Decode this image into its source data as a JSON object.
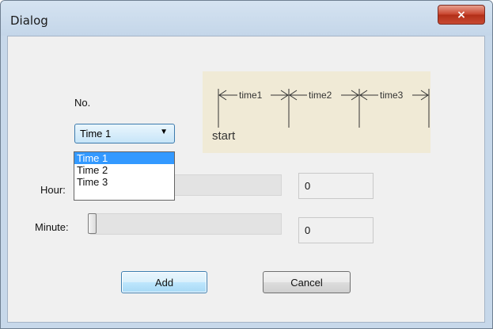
{
  "window": {
    "title": "Dialog",
    "close_glyph": "×"
  },
  "labels": {
    "no": "No.",
    "hour": "Hour:",
    "minute": "Minute:"
  },
  "select": {
    "value": "Time 1",
    "options": [
      "Time 1",
      "Time 2",
      "Time 3"
    ],
    "selected_index": 0
  },
  "diagram": {
    "segments": [
      "time1",
      "time2",
      "time3"
    ],
    "start_label": "start"
  },
  "hour": {
    "value": "0",
    "slider_level": 0
  },
  "minute": {
    "value": "0",
    "slider_level": 0
  },
  "buttons": {
    "add": "Add",
    "cancel": "Cancel"
  },
  "colors": {
    "selection": "#3399ff",
    "diagram_bg": "#f0ead6",
    "close_button": "#c9452f"
  },
  "icons": {
    "close": "close-icon",
    "dropdown": "chevron-down-icon"
  }
}
